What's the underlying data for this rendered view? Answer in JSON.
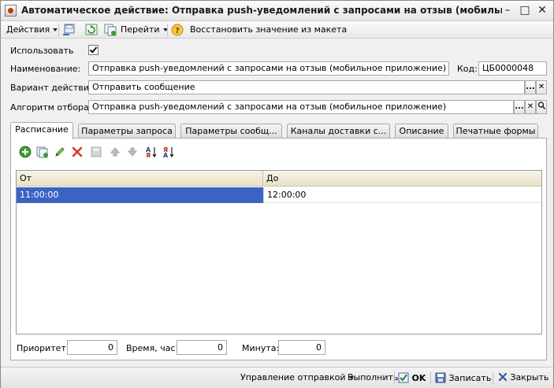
{
  "window": {
    "title": "Автоматическое действие: Отправка push-уведомлений с запросами на отзыв (мобильное приложе...",
    "minimize_glyph": "–",
    "restore_glyph": "□",
    "close_glyph": "✕"
  },
  "menubar": {
    "actions_label": "Действия",
    "goto_label": "Перейти",
    "restore_label": "Восстановить значение из макета"
  },
  "form": {
    "use_label": "Использовать",
    "use_checked": true,
    "name_label": "Наименование:",
    "name_value": "Отправка push-уведомлений с запросами на отзыв (мобильное приложение)",
    "code_label": "Код:",
    "code_value": "ЦБ0000048",
    "variant_label": "Вариант действия:",
    "variant_value": "Отправить сообщение",
    "algorithm_label": "Алгоритм отбора:",
    "algorithm_value": "Отправка push-уведомлений с запросами на отзыв (мобильное приложение)",
    "select_glyph": "...",
    "clear_glyph": "✕",
    "open_glyph": "🔍"
  },
  "tabs": [
    {
      "label": "Расписание",
      "active": true
    },
    {
      "label": "Параметры запроса",
      "active": false
    },
    {
      "label": "Параметры сообщ...",
      "active": false
    },
    {
      "label": "Каналы доставки с...",
      "active": false
    },
    {
      "label": "Описание",
      "active": false
    },
    {
      "label": "Печатные формы",
      "active": false
    }
  ],
  "schedule": {
    "columns": [
      "От",
      "До"
    ],
    "rows": [
      {
        "from": "11:00:00",
        "to": "12:00:00"
      }
    ],
    "priority_label": "Приоритет:",
    "priority_value": "0",
    "time_label": "Время, час:",
    "time_value": "0",
    "minute_label": "Минута:",
    "minute_value": "0"
  },
  "bottombar": {
    "manage_label": "Управление отправкой",
    "execute_label": "Выполнить",
    "ok_label": "OK",
    "save_label": "Записать",
    "close_label": "Закрыть"
  },
  "colors": {
    "selection": "#3a63c3",
    "header_bg": "#ede7cf",
    "window_bg": "#f0f0f0",
    "delete_red": "#d63a2c",
    "add_green": "#3c9d2f"
  }
}
